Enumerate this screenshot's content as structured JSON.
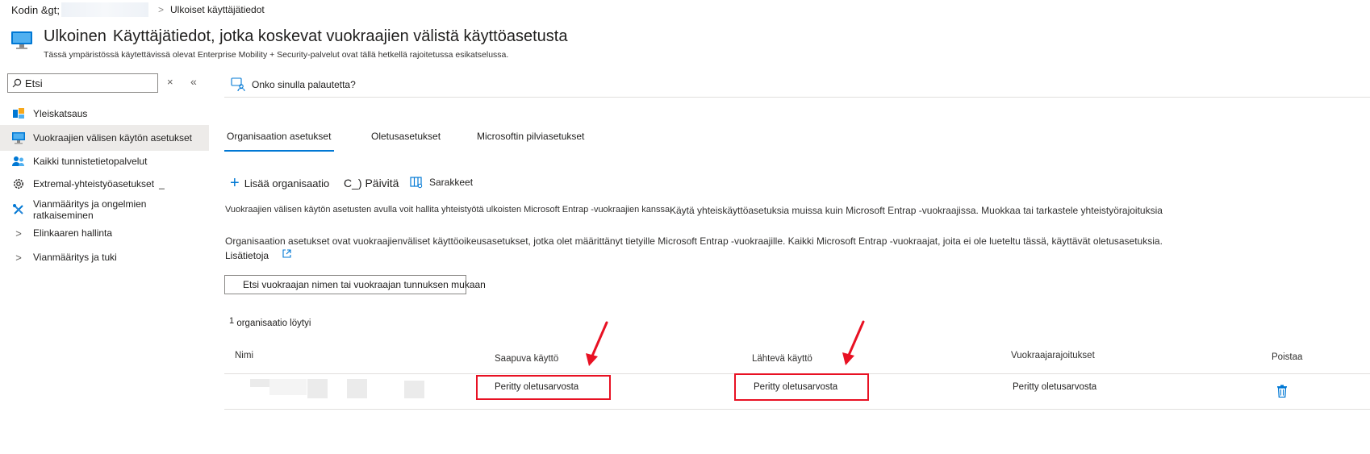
{
  "breadcrumb": {
    "home": "Kodin &gt;",
    "current": "Ulkoiset käyttäjätiedot"
  },
  "header": {
    "title_part1": "Ulkoinen",
    "title_part2": "Käyttäjätiedot, jotka koskevat vuokraajien välistä käyttöasetusta",
    "subtitle": "Tässä ympäristössä käytettävissä olevat Enterprise Mobility + Security-palvelut ovat tällä hetkellä rajoitetussa esikatselussa."
  },
  "sidebar": {
    "search_value": "Etsi",
    "clear_glyph": "×",
    "collapse_glyph": "«",
    "items": [
      {
        "label": "Yleiskatsaus"
      },
      {
        "label": "Vuokraajien välisen käytön asetukset"
      },
      {
        "label": "Kaikki tunnistetietopalvelut"
      },
      {
        "label": "Extremal-yhteistyöasetukset"
      },
      {
        "label": "Vianmääritys ja ongelmien ratkaiseminen"
      },
      {
        "label": "Elinkaaren hallinta"
      },
      {
        "label": "Vianmääritys ja tuki"
      }
    ]
  },
  "feedback": {
    "label": "Onko sinulla palautetta?"
  },
  "tabs": [
    {
      "label": "Organisaation asetukset"
    },
    {
      "label": "Oletusasetukset"
    },
    {
      "label": "Microsoftin pilviasetukset"
    }
  ],
  "toolbar": {
    "add_org": "Lisää organisaatio",
    "refresh": "C_) Päivitä",
    "columns": "Sarakkeet"
  },
  "info": {
    "line1a": "Vuokraajien välisen käytön asetusten avulla voit hallita yhteistyötä ulkoisten Microsoft Entrap -vuokraajien kanssa.",
    "line1b": "Käytä yhteiskäyttöasetuksia muissa kuin Microsoft Entrap -vuokraajissa. Muokkaa tai tarkastele yhteistyörajoituksia",
    "line2": "Organisaation asetukset ovat vuokraajienväliset käyttöoikeusasetukset, jotka olet määrittänyt tietyille Microsoft Entrap -vuokraajille. Kaikki Microsoft Entrap -vuokraajat, joita ei ole lueteltu tässä, käyttävät oletusasetuksia.",
    "learn_more": "Lisätietoja"
  },
  "tenant_search": {
    "value": "Etsi vuokraajan nimen tai vuokraajan tunnuksen mukaan"
  },
  "results": {
    "count_num": "1",
    "count_text": "organisaatio löytyi"
  },
  "table": {
    "headers": [
      "Nimi",
      "Saapuva käyttö",
      "Lähtevä käyttö",
      "Vuokraajarajoitukset",
      "Poistaa"
    ],
    "row": {
      "inbound": "Peritty oletusarvosta",
      "outbound": "Peritty oletusarvosta",
      "restrictions": "Peritty oletusarvosta"
    }
  },
  "colors": {
    "accent": "#0078d4",
    "annotation_red": "#e81123",
    "active_nav": "#edebe9"
  },
  "icons": {
    "header": "monitor-icon",
    "search": "search-icon",
    "feedback": "feedback-person-icon",
    "delete": "trash-icon",
    "external_link": "external-link-icon"
  }
}
